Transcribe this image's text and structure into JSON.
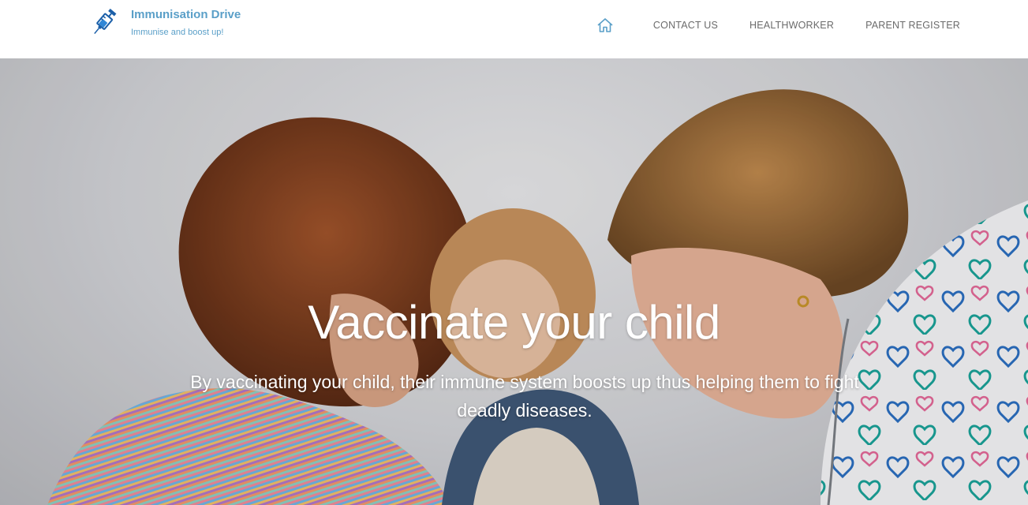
{
  "brand": {
    "title": "Immunisation Drive",
    "subtitle": "Immunise and boost up!",
    "logo_icon": "syringe-icon"
  },
  "nav": {
    "home_icon": "home-icon",
    "items": [
      {
        "label": "CONTACT US"
      },
      {
        "label": "HEALTHWORKER"
      },
      {
        "label": "PARENT REGISTER"
      }
    ]
  },
  "hero": {
    "title": "Vaccinate your child",
    "subtitle": "By vaccinating your child, their immune system boosts up thus helping them to fight deadly diseases.",
    "image": "mother-child-nurse-photo"
  },
  "colors": {
    "brand": "#5a9fc8",
    "nav_text": "#6b6b6b",
    "hero_text": "#ffffff"
  }
}
